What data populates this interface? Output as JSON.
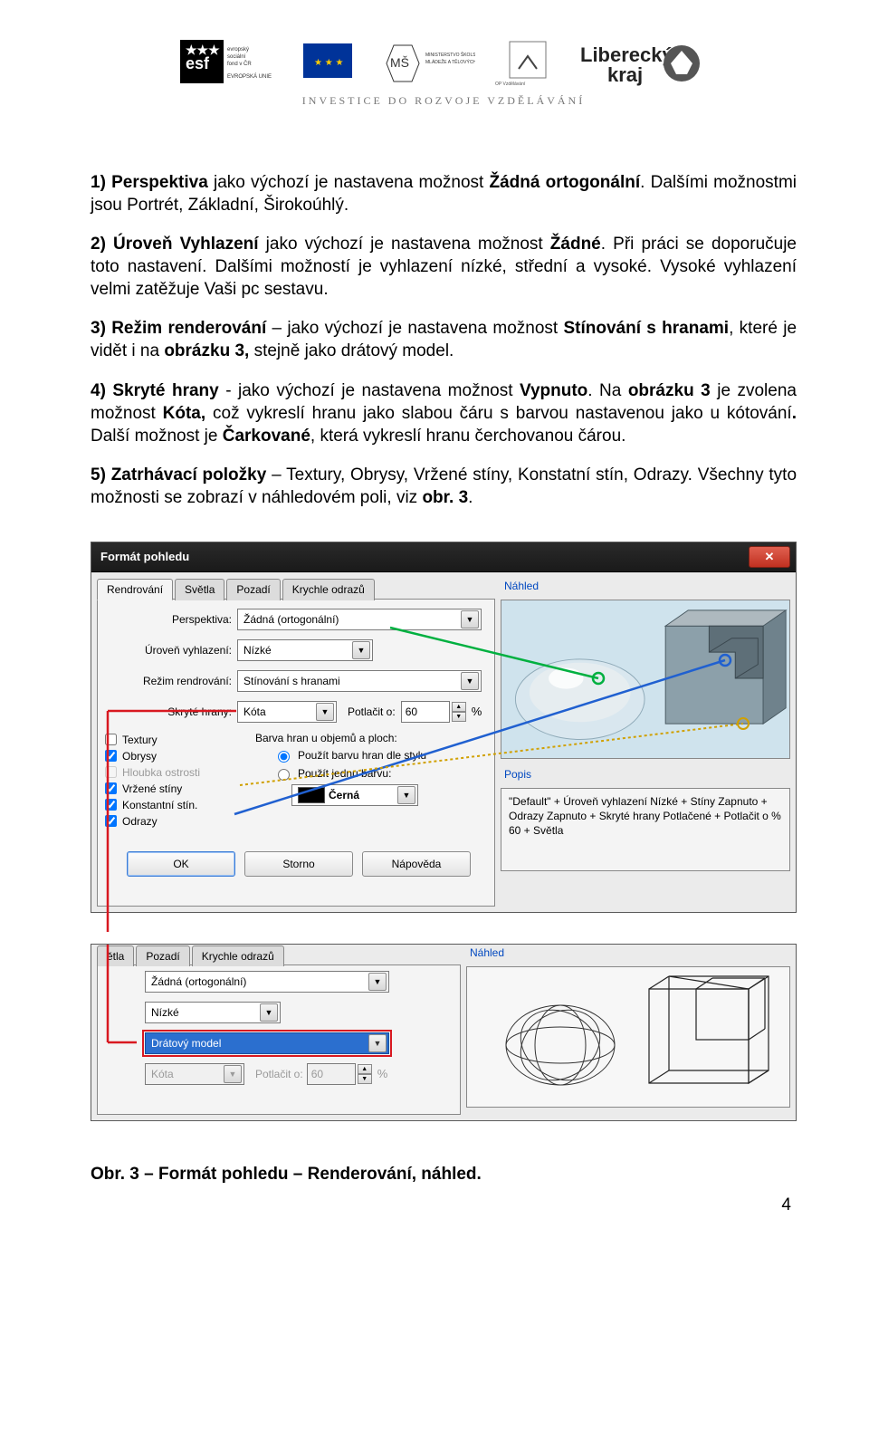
{
  "logos": {
    "esf": "evropský sociální fond v ČR · EVROPSKÁ UNIE",
    "msmt": "MINISTERSTVO ŠKOLSTVÍ, MLÁDEŽE A TĚLOVÝCHOVY",
    "opvk": "OP Vzdělávání pro konkurenceschopnost",
    "kraj": "Liberecký kraj"
  },
  "invest_line": "INVESTICE DO ROZVOJE VZDĚLÁVÁNÍ",
  "paragraphs": {
    "p1a": "1) Perspektiva",
    "p1b": " jako výchozí je nastavena možnost ",
    "p1c": "Žádná ortogonální",
    "p1d": ". Dalšími možnostmi jsou Portrét, Základní, Širokoúhlý.",
    "p2a": "2) Úroveň Vyhlazení",
    "p2b": " jako výchozí je nastavena možnost ",
    "p2c": "Žádné",
    "p2d": ". Při práci se doporučuje toto nastavení. Dalšími možností je vyhlazení nízké, střední a vysoké. Vysoké vyhlazení velmi zatěžuje Vaši pc sestavu.",
    "p3a": "3) Režim renderování",
    "p3b": " – jako výchozí je nastavena možnost ",
    "p3c": "Stínování s hranami",
    "p3d": ", které je vidět i na ",
    "p3e": "obrázku 3,",
    "p3f": " stejně jako drátový model.",
    "p4a": "4) Skryté hrany",
    "p4b": " - jako výchozí je nastavena možnost ",
    "p4c": "Vypnuto",
    "p4d": ". Na ",
    "p4e": "obrázku 3",
    "p4f": " je zvolena možnost ",
    "p4g": "Kóta,",
    "p4h": " což vykreslí hranu jako slabou čáru s barvou nastavenou jako u kótování",
    "p4i": ".",
    "p4j": " Další možnost je ",
    "p4k": "Čarkované",
    "p4l": ", která vykreslí hranu čerchovanou čárou.",
    "p5a": "5) Zatrhávací položky",
    "p5b": " – Textury, Obrysy, Vržené stíny, Konstatní stín, Odrazy. Všechny tyto možnosti se zobrazí v náhledovém poli, viz ",
    "p5c": "obr. 3",
    "p5d": "."
  },
  "dialog": {
    "title": "Formát pohledu",
    "tabs": [
      "Rendrování",
      "Světla",
      "Pozadí",
      "Krychle odrazů"
    ],
    "active_tab": 0,
    "labels": {
      "perspektiva": "Perspektiva:",
      "uroven": "Úroveň vyhlazení:",
      "rezim": "Režim rendrování:",
      "skryte": "Skryté hrany:",
      "potlacit": "Potlačit o:",
      "percent": "%",
      "barva_hran": "Barva hran u objemů a ploch:",
      "radio1": "Použít barvu hran dle stylu",
      "radio2": "Použít jednu barvu:",
      "color_name": "Černá"
    },
    "values": {
      "perspektiva": "Žádná (ortogonální)",
      "uroven": "Nízké",
      "rezim": "Stínování s hranami",
      "skryte": "Kóta",
      "potlacit": "60"
    },
    "checks": [
      {
        "label": "Textury",
        "checked": false,
        "disabled": false
      },
      {
        "label": "Obrysy",
        "checked": true,
        "disabled": false
      },
      {
        "label": "Hloubka ostrosti",
        "checked": false,
        "disabled": true
      },
      {
        "label": "Vržené stíny",
        "checked": true,
        "disabled": false
      },
      {
        "label": "Konstantní stín.",
        "checked": true,
        "disabled": false
      },
      {
        "label": "Odrazy",
        "checked": true,
        "disabled": false
      }
    ],
    "buttons": {
      "ok": "OK",
      "storno": "Storno",
      "help": "Nápověda"
    },
    "nahled": "Náhled",
    "popis_label": "Popis",
    "popis_text": "\"Default\" + Úroveň vyhlazení Nízké + Stíny Zapnuto + Odrazy Zapnuto + Skryté hrany Potlačené + Potlačit o % 60 + Světla"
  },
  "dialog2": {
    "tabs_visible": [
      "ětla",
      "Pozadí",
      "Krychle odrazů"
    ],
    "values": {
      "perspektiva": "Žádná (ortogonální)",
      "uroven": "Nízké",
      "rezim": "Drátový model",
      "skryte": "Kóta",
      "potlacit": "60"
    },
    "labels": {
      "potlacit": "Potlačit o:",
      "percent": "%"
    },
    "nahled": "Náhled"
  },
  "caption": "Obr. 3 – Formát pohledu – Renderování, náhled.",
  "page_number": "4"
}
